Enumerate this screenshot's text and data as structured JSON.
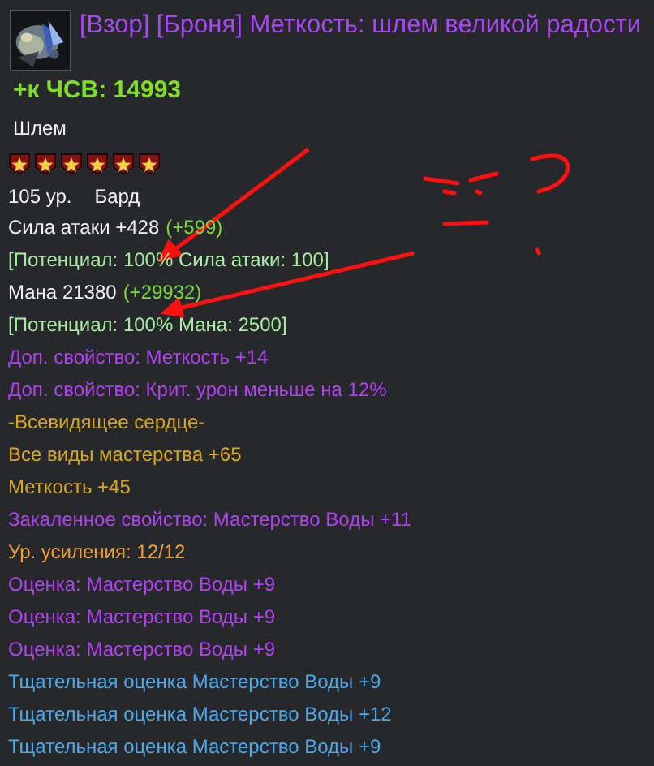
{
  "item": {
    "title": "[Взор] [Броня] Меткость: шлем великой радости",
    "bonus": "+к ЧСВ: 14993",
    "type": "Шлем",
    "stars": 6,
    "level": "105 ур.",
    "class": "Бард"
  },
  "lines": [
    {
      "kind": "white",
      "text": "Сила атаки +428",
      "bonus": "(+599)"
    },
    {
      "kind": "potential",
      "text": "[Потенциал: 100% Сила атаки: 100]"
    },
    {
      "kind": "white",
      "text": "Мана 21380",
      "bonus": "(+29932)"
    },
    {
      "kind": "potential",
      "text": "[Потенциал: 100% Мана: 2500]"
    },
    {
      "kind": "purple",
      "text": "Доп. свойство: Меткость +14"
    },
    {
      "kind": "purple",
      "text": "Доп. свойство: Крит. урон меньше на 12%"
    },
    {
      "kind": "gold",
      "text": "-Всевидящее сердце-"
    },
    {
      "kind": "gold",
      "text": "Все виды мастерства +65"
    },
    {
      "kind": "gold",
      "text": "Меткость +45"
    },
    {
      "kind": "purple",
      "text": "Закаленное свойство: Мастерство Воды +11"
    },
    {
      "kind": "orange",
      "text": "Ур. усиления: 12/12"
    },
    {
      "kind": "purple",
      "text": "Оценка:  Мастерство Воды +9"
    },
    {
      "kind": "purple",
      "text": "Оценка:  Мастерство Воды +9"
    },
    {
      "kind": "purple",
      "text": "Оценка:  Мастерство Воды +9"
    },
    {
      "kind": "blue",
      "text": "Тщательная оценка Мастерство Воды +9"
    },
    {
      "kind": "blue",
      "text": "Тщательная оценка Мастерство Воды +12"
    },
    {
      "kind": "blue",
      "text": "Тщательная оценка Мастерство Воды +9"
    }
  ]
}
